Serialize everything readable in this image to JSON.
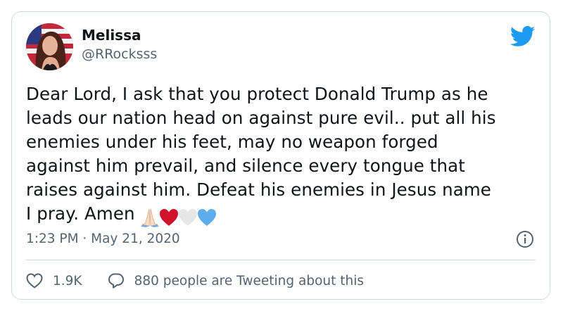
{
  "tweet": {
    "author_name": "Melissa",
    "author_handle": "@RRocksss",
    "text": "Dear Lord, I ask that you protect Donald Trump as he\nleads our nation head on against pure evil.. put all his\nenemies under his feet, may no weapon forged\nagainst him prevail, and silence every tongue that\nraises against him. Defeat his enemies in Jesus name\nI pray. Amen",
    "emojis": [
      "folded-hands",
      "red-heart",
      "white-heart",
      "blue-heart"
    ],
    "timestamp": "1:23 PM · May 21, 2020",
    "like_count": "1.9K",
    "reply_text": "880 people are Tweeting about this"
  },
  "colors": {
    "text": "#0f1419",
    "secondary": "#536471",
    "twitter_blue": "#1d9bf0",
    "border": "#cfd9de",
    "red_heart": "#d0112b",
    "white_heart": "#e6e6e6",
    "blue_heart": "#5dadec"
  },
  "icons": {
    "brand": "twitter-bird-icon",
    "info": "info-icon",
    "like": "heart-outline-icon",
    "reply": "speech-bubble-icon"
  }
}
